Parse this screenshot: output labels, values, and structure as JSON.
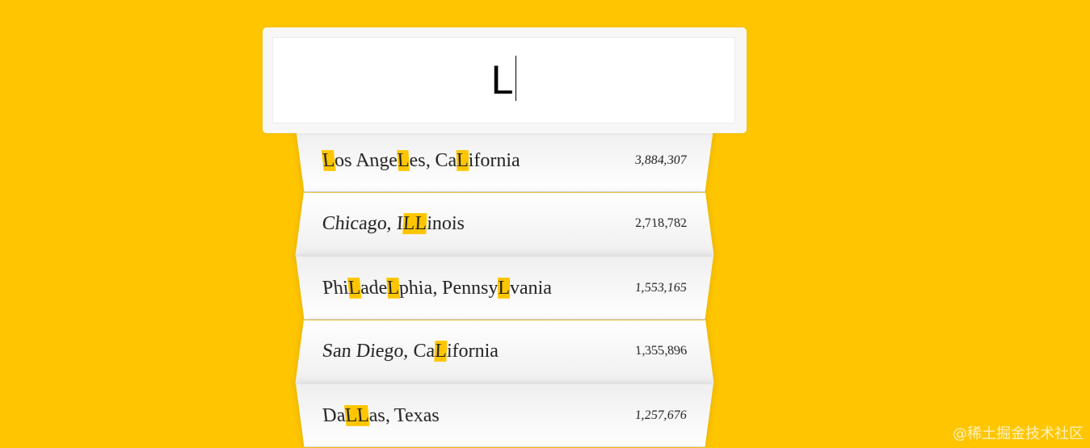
{
  "search": {
    "value": "L",
    "highlight_color": "#ffc600"
  },
  "colors": {
    "background": "#ffc600",
    "row_background": "#ffffff",
    "row_text": "#222222"
  },
  "suggestions": [
    {
      "city": "Los Angeles, California",
      "population": "3,884,307",
      "parts": [
        {
          "text": "L",
          "hl": true
        },
        {
          "text": "os Ange",
          "hl": false
        },
        {
          "text": "L",
          "hl": true
        },
        {
          "text": "es, Ca",
          "hl": false
        },
        {
          "text": "L",
          "hl": true
        },
        {
          "text": "ifornia",
          "hl": false
        }
      ]
    },
    {
      "city": "Chicago, Illinois",
      "population": "2,718,782",
      "parts": [
        {
          "text": "Chicago, I",
          "hl": false
        },
        {
          "text": "LL",
          "hl": true
        },
        {
          "text": "inois",
          "hl": false
        }
      ]
    },
    {
      "city": "Philadelphia, Pennsylvania",
      "population": "1,553,165",
      "parts": [
        {
          "text": "Phi",
          "hl": false
        },
        {
          "text": "L",
          "hl": true
        },
        {
          "text": "ade",
          "hl": false
        },
        {
          "text": "L",
          "hl": true
        },
        {
          "text": "phia, Pennsy",
          "hl": false
        },
        {
          "text": "L",
          "hl": true
        },
        {
          "text": "vania",
          "hl": false
        }
      ]
    },
    {
      "city": "San Diego, California",
      "population": "1,355,896",
      "parts": [
        {
          "text": "San Diego, Ca",
          "hl": false
        },
        {
          "text": "L",
          "hl": true
        },
        {
          "text": "ifornia",
          "hl": false
        }
      ]
    },
    {
      "city": "Dallas, Texas",
      "population": "1,257,676",
      "parts": [
        {
          "text": "Da",
          "hl": false
        },
        {
          "text": "LL",
          "hl": true
        },
        {
          "text": "as, Texas",
          "hl": false
        }
      ]
    }
  ],
  "watermark": "@稀土掘金技术社区"
}
